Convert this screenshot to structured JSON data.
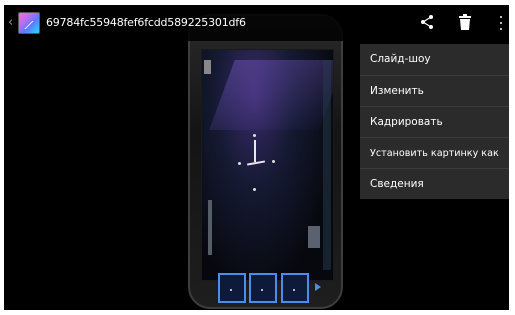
{
  "action_bar": {
    "title": "69784fc55948fef6fcdd589225301df6",
    "icons": [
      "up-caret-icon",
      "image-thumbnail-icon",
      "share-icon",
      "trash-icon",
      "overflow-menu-icon"
    ]
  },
  "overflow_menu": {
    "items": [
      {
        "label": "Слайд-шоу"
      },
      {
        "label": "Изменить"
      },
      {
        "label": "Кадрировать"
      },
      {
        "label": "Установить картинку как"
      },
      {
        "label": "Сведения"
      }
    ]
  },
  "colors": {
    "background": "#000000",
    "menu_background": "#2b2b2b",
    "menu_divider": "#3c3c3c",
    "accent": "#4a8df0",
    "text": "#ffffff"
  }
}
